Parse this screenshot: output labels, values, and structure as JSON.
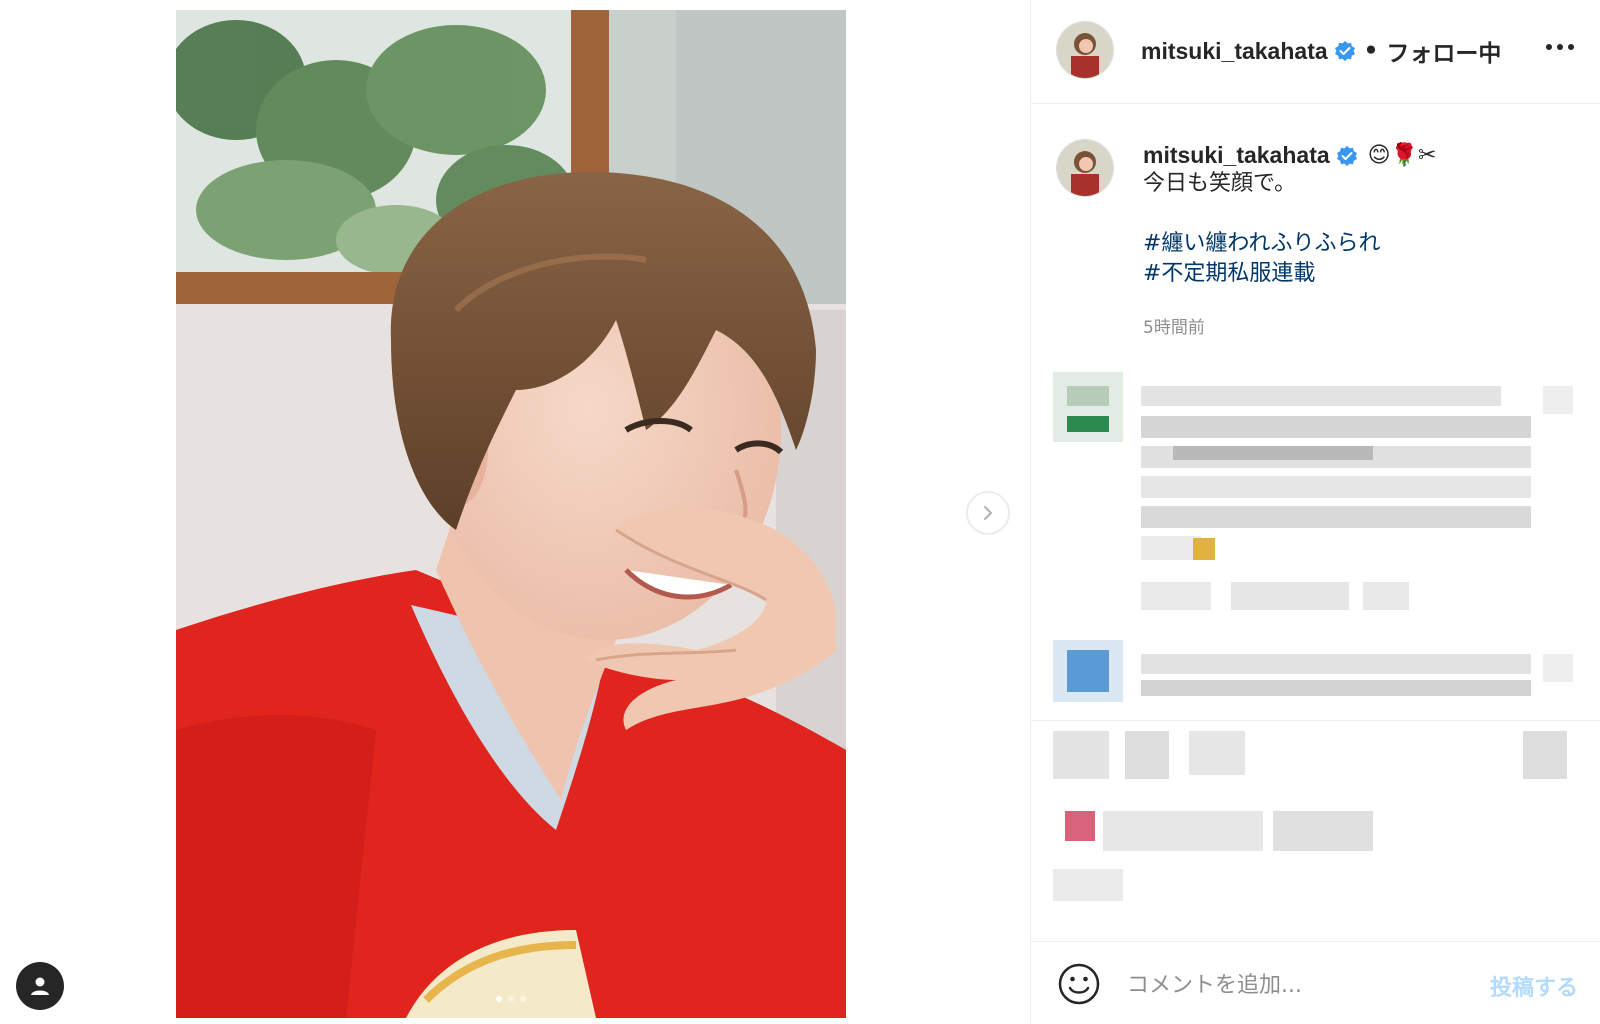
{
  "post": {
    "username": "mitsuki_takahata",
    "follow_status": "フォロー中",
    "separator": "•"
  },
  "caption": {
    "username": "mitsuki_takahata",
    "emoji": "😊🌹✂",
    "text": "今日も笑顔で。",
    "hashtags": [
      "#纏い纏われふりふられ",
      "#不定期私服連載"
    ],
    "time": "5時間前"
  },
  "comment_box": {
    "placeholder": "コメントを追加...",
    "post_label": "投稿する"
  },
  "carousel": {
    "total": 3,
    "current": 1
  },
  "icons": {
    "verified": "verified-badge-icon",
    "more": "more-options-icon",
    "next": "chevron-right-icon",
    "user_tag": "user-tag-icon",
    "emoji": "emoji-smile-icon"
  },
  "colors": {
    "verified_blue": "#3897f0",
    "hashtag": "#00376b",
    "post_disabled": "#b3dbff",
    "sweater_red": "#e0241e"
  }
}
